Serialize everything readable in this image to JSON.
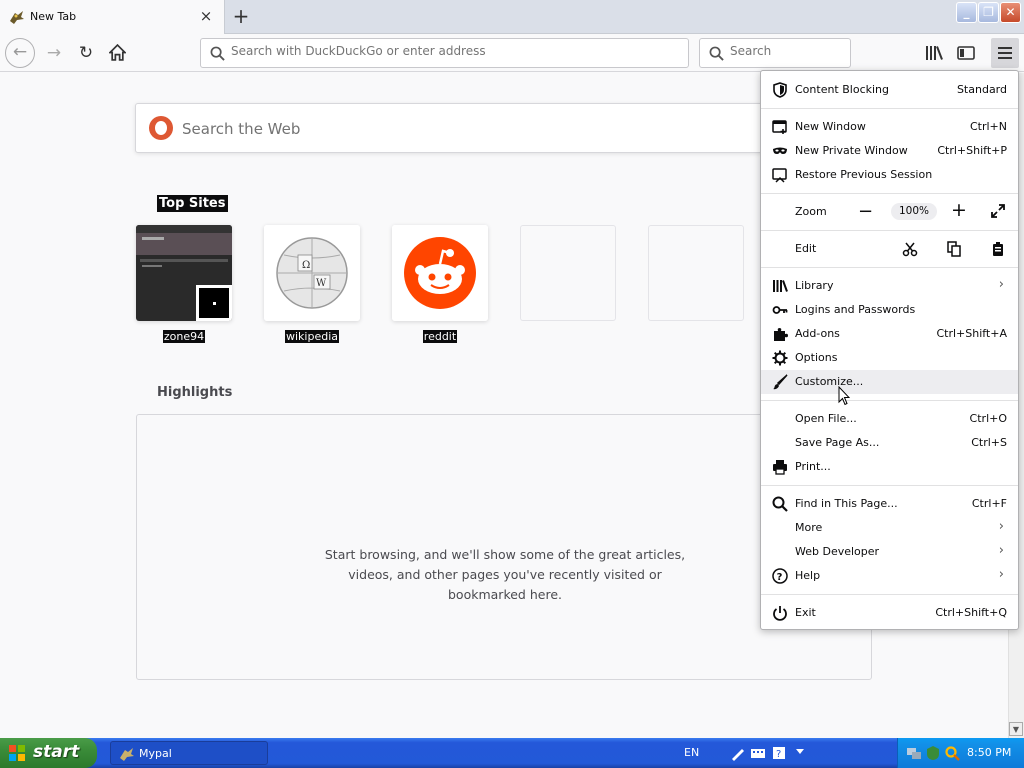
{
  "tab": {
    "title": "New Tab",
    "close": "×",
    "new_tab": "+"
  },
  "window_buttons": {
    "minimize": "_",
    "restore": "❐",
    "close": "✕"
  },
  "nav": {
    "back": "←",
    "forward": "→",
    "reload": "↻",
    "url_placeholder": "Search with DuckDuckGo or enter address",
    "search_placeholder": "Search"
  },
  "page": {
    "search_placeholder": "Search the Web",
    "top_sites_title": "Top Sites",
    "top_sites": [
      {
        "label": "zone94"
      },
      {
        "label": "wikipedia"
      },
      {
        "label": "reddit"
      }
    ],
    "highlights_title": "Highlights",
    "highlights_message": "Start browsing, and we'll show some of the great articles, videos, and other pages you've recently visited or bookmarked here."
  },
  "menu": {
    "content_blocking": {
      "label": "Content Blocking",
      "value": "Standard"
    },
    "new_window": {
      "label": "New Window",
      "shortcut": "Ctrl+N"
    },
    "new_private_window": {
      "label": "New Private Window",
      "shortcut": "Ctrl+Shift+P"
    },
    "restore_session": {
      "label": "Restore Previous Session"
    },
    "zoom": {
      "label": "Zoom",
      "minus": "−",
      "value": "100%",
      "plus": "+"
    },
    "edit": {
      "label": "Edit"
    },
    "library": {
      "label": "Library",
      "arrow": "›"
    },
    "logins": {
      "label": "Logins and Passwords"
    },
    "addons": {
      "label": "Add-ons",
      "shortcut": "Ctrl+Shift+A"
    },
    "options": {
      "label": "Options"
    },
    "customize": {
      "label": "Customize..."
    },
    "open_file": {
      "label": "Open File...",
      "shortcut": "Ctrl+O"
    },
    "save_page": {
      "label": "Save Page As...",
      "shortcut": "Ctrl+S"
    },
    "print": {
      "label": "Print..."
    },
    "find": {
      "label": "Find in This Page...",
      "shortcut": "Ctrl+F"
    },
    "more": {
      "label": "More",
      "arrow": "›"
    },
    "web_developer": {
      "label": "Web Developer",
      "arrow": "›"
    },
    "help": {
      "label": "Help",
      "arrow": "›"
    },
    "exit": {
      "label": "Exit",
      "shortcut": "Ctrl+Shift+Q"
    }
  },
  "taskbar": {
    "start": "start",
    "task": "Mypal",
    "language": "EN",
    "clock": "8:50 PM"
  },
  "colors": {
    "ddg_orange": "#de5833",
    "reddit_orange": "#ff4500",
    "xp_blue": "#2458d9",
    "xp_green": "#3a8c39"
  }
}
